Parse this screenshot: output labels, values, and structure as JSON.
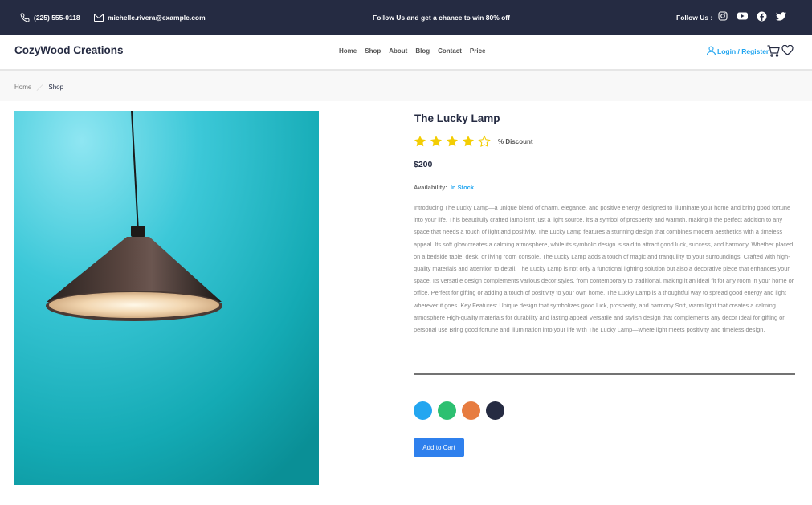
{
  "topbar": {
    "phone": "(225) 555-0118",
    "email": "michelle.rivera@example.com",
    "promo": "Follow Us and get a chance to win 80% off",
    "follow_label": "Follow Us :",
    "social_icons": [
      "instagram-icon",
      "youtube-icon",
      "facebook-icon",
      "twitter-icon"
    ],
    "background": "#252B42"
  },
  "nav": {
    "brand": "CozyWood Creations",
    "items": [
      "Home",
      "Shop",
      "About",
      "Blog",
      "Contact",
      "Price"
    ],
    "login": "Login / Register",
    "accent": "#23A6F0"
  },
  "breadcrumb": {
    "home": "Home",
    "current": "Shop"
  },
  "product": {
    "title": "The Lucky Lamp",
    "rating": 4,
    "rating_max": 5,
    "discount": "% Discount",
    "price": "$200",
    "availability_label": "Availability:",
    "availability_value": "In Stock",
    "description": "Introducing The Lucky Lamp—a unique blend of charm, elegance, and positive energy designed to illuminate your home and bring good fortune into your life. This beautifully crafted lamp isn't just a light source, it's a symbol of prosperity and warmth, making it the perfect addition to any space that needs a touch of light and positivity. The Lucky Lamp features a stunning design that combines modern aesthetics with a timeless appeal. Its soft glow creates a calming atmosphere, while its symbolic design is said to attract good luck, success, and harmony. Whether placed on a bedside table, desk, or living room console, The Lucky Lamp adds a touch of magic and tranquility to your surroundings. Crafted with high-quality materials and attention to detail, The Lucky Lamp is not only a functional lighting solution but also a decorative piece that enhances your space. Its versatile design complements various decor styles, from contemporary to traditional, making it an ideal fit for any room in your home or office. Perfect for gifting or adding a touch of positivity to your own home, The Lucky Lamp is a thoughtful way to spread good energy and light wherever it goes. Key Features: Unique design that symbolizes good luck, prosperity, and harmony Soft, warm light that creates a calming atmosphere High-quality materials for durability and lasting appeal Versatile and stylish design that complements any decor Ideal for gifting or personal use Bring good fortune and illumination into your life with The Lucky Lamp—where light meets positivity and timeless design.",
    "colors": [
      "#23A6F0",
      "#2DC071",
      "#E77C40",
      "#252B42"
    ],
    "add_to_cart": "Add to Cart",
    "button_color": "#2F80ED",
    "image_icon": "pendant-lamp-image"
  }
}
